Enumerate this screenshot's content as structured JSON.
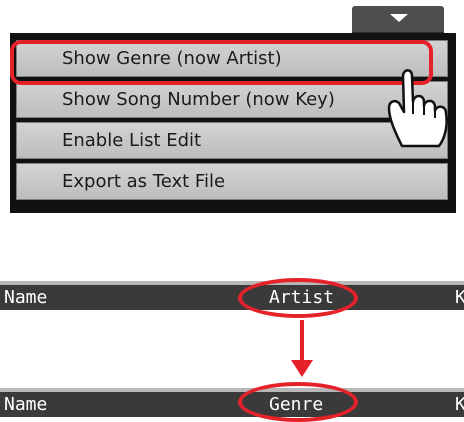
{
  "menu": {
    "items": [
      {
        "label": "Show Genre (now Artist)"
      },
      {
        "label": "Show Song Number (now Key)"
      },
      {
        "label": "Enable List Edit"
      },
      {
        "label": "Export as Text File"
      }
    ]
  },
  "header_before": {
    "name": "Name",
    "column": "Artist",
    "next": "K"
  },
  "header_after": {
    "name": "Name",
    "column": "Genre",
    "next": "K"
  },
  "colors": {
    "highlight": "#e5222a",
    "menu_bg": "#111111",
    "header_bg": "#3a3a3a"
  },
  "icons": [
    "chevron-down-icon",
    "pointing-hand-icon",
    "arrow-down-icon"
  ]
}
